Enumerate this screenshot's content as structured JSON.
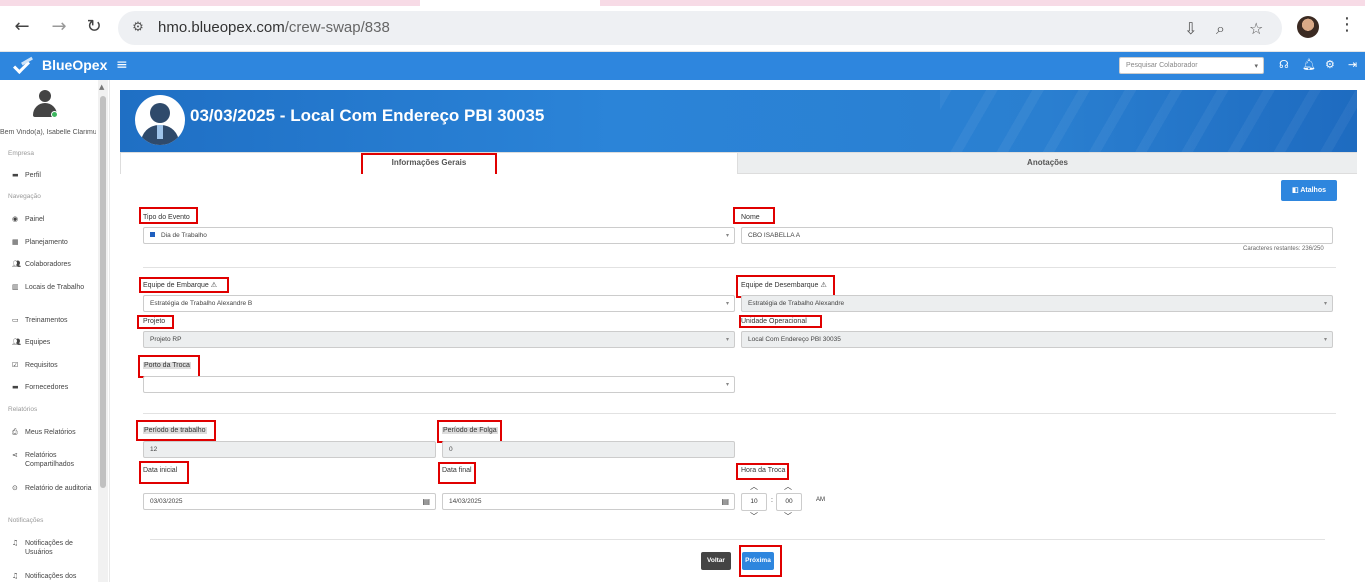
{
  "browser": {
    "url_host": "hmo.blueopex.com",
    "url_path": "/crew-swap/838"
  },
  "header": {
    "brand": "BlueOpex",
    "search_placeholder": "Pesquisar Colaborador"
  },
  "sidebar": {
    "welcome": "Bem Vindo(a), Isabelle Clarimun",
    "sections": {
      "empresa": "Empresa",
      "navegacao": "Navegação",
      "relatorios": "Relatórios",
      "notificacoes": "Notificações"
    },
    "items": {
      "perfil": "Perfil",
      "painel": "Painel",
      "planejamento": "Planejamento",
      "colaboradores": "Colaboradores",
      "locais": "Locais de Trabalho",
      "treinamentos": "Treinamentos",
      "equipes": "Equipes",
      "requisitos": "Requisitos",
      "fornecedores": "Fornecedores",
      "meus_relatorios": "Meus Relatórios",
      "rel_compartilhados": "Relatórios Compartilhados",
      "rel_auditoria": "Relatório de auditoria",
      "notif_usuarios": "Notificações de Usuários",
      "notif_dos": "Notificações dos"
    }
  },
  "hero": {
    "title": "03/03/2025 - Local Com Endereço PBI 30035"
  },
  "tabs": {
    "info": "Informações Gerais",
    "notes": "Anotações"
  },
  "form": {
    "atalhos": "Atalhos",
    "tipo_evento_label": "Tipo do Evento",
    "tipo_evento_value": "Dia de Trabalho",
    "nome_label": "Nome",
    "nome_value": "CBO ISABELLA A",
    "chars_remaining": "Caracteres restantes: 236/250",
    "equipe_embarque_label": "Equipe de Embarque",
    "equipe_embarque_value": "Estratégia de Trabalho Alexandre B",
    "equipe_desembarque_label": "Equipe de Desembarque",
    "equipe_desembarque_value": "Estratégia de Trabalho Alexandre",
    "projeto_label": "Projeto",
    "projeto_value": "Projeto RP",
    "unidade_label": "Unidade Operacional",
    "unidade_value": "Local Com Endereço PBI 30035",
    "porto_label": "Porto da Troca",
    "porto_value": "",
    "periodo_trabalho_label": "Período de trabalho",
    "periodo_trabalho_value": "12",
    "periodo_folga_label": "Período de Folga",
    "periodo_folga_value": "0",
    "data_inicial_label": "Data inicial",
    "data_inicial_value": "03/03/2025",
    "data_final_label": "Data final",
    "data_final_value": "14/03/2025",
    "hora_label": "Hora da Troca",
    "hora_h": "10",
    "hora_m": "00",
    "ampm": "AM",
    "voltar": "Voltar",
    "proxima": "Próxima"
  }
}
